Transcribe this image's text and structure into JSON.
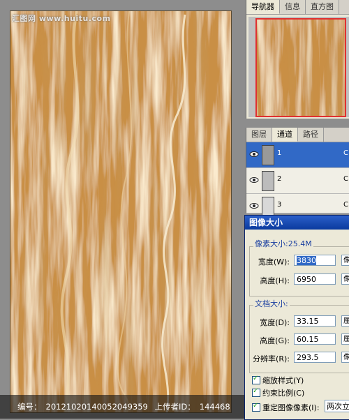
{
  "watermark_top": "汇图网 www.huitu.com",
  "bottom_bar": {
    "id_label": "编号：",
    "id_value": "20121020140052049359",
    "uploader_label": "上传者ID：",
    "uploader_value": "144468"
  },
  "navigator": {
    "tabs": [
      "导航器",
      "信息",
      "直方图"
    ]
  },
  "channels": {
    "tabs": [
      "图层",
      "通道",
      "路径"
    ],
    "rows": [
      {
        "label": "1",
        "shortcut": "C"
      },
      {
        "label": "2",
        "shortcut": "C"
      },
      {
        "label": "3",
        "shortcut": "C"
      }
    ]
  },
  "dialog": {
    "title": "图像大小",
    "pixel_size_label": "像素大小:25.4M",
    "width_label": "宽度(W):",
    "width_value": "3830",
    "height_label": "高度(H):",
    "height_value": "6950",
    "pixel_unit": "像",
    "doc_size_label": "文档大小:",
    "doc_width_label": "宽度(D):",
    "doc_width_value": "33.15",
    "doc_height_label": "高度(G):",
    "doc_height_value": "60.15",
    "resolution_label": "分辨率(R):",
    "resolution_value": "293.5",
    "doc_unit": "厘",
    "res_unit": "像",
    "scale_styles": "缩放样式(Y)",
    "constrain": "约束比例(C)",
    "resample": "重定图像像素(I):",
    "resample_method": "两次立方"
  },
  "colors": {
    "marble_base": "#c98f45",
    "selection_blue": "#3169c6"
  }
}
